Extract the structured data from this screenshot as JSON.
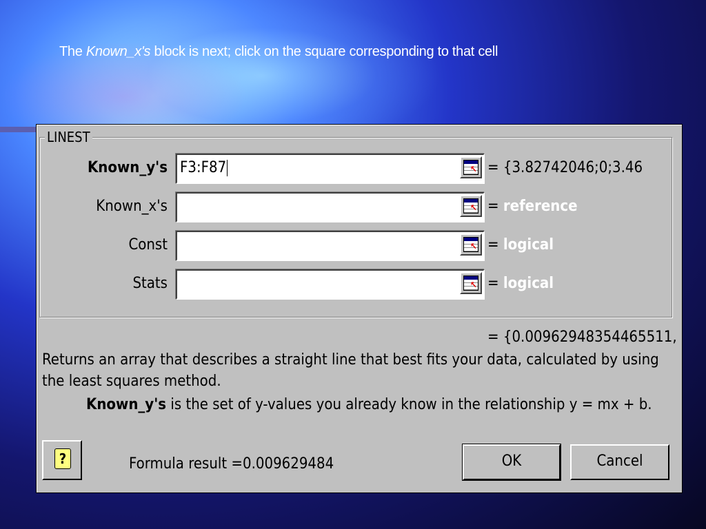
{
  "slide": {
    "headline_before": "The ",
    "headline_italic": "Known_x's",
    "headline_after": " block is next; click on the square corresponding to that cell"
  },
  "dialog": {
    "group_title": "LINEST",
    "args": [
      {
        "label": "Known_y's",
        "bold": true,
        "value": "F3:F87",
        "eq": "= ",
        "result": "{3.82742046;0;3.46",
        "result_is_hint": false
      },
      {
        "label": "Known_x's",
        "bold": false,
        "value": "",
        "eq": "= ",
        "result": "reference",
        "result_is_hint": true
      },
      {
        "label": "Const",
        "bold": false,
        "value": "",
        "eq": "= ",
        "result": "logical",
        "result_is_hint": true
      },
      {
        "label": "Stats",
        "bold": false,
        "value": "",
        "eq": "= ",
        "result": "logical",
        "result_is_hint": true
      }
    ],
    "overall_result": "= {0.00962948354465511,",
    "description": "Returns an array that describes a straight line that best fits your data, calculated by using the least squares method.",
    "arg_name": "Known_y's",
    "arg_description": " is the set of y-values you already know in the relationship y = mx + b.",
    "formula_result": "Formula result =0.009629484",
    "help_glyph": "?",
    "ok_label": "OK",
    "cancel_label": "Cancel",
    "collapse_icon": "collapse-dialog-icon"
  }
}
